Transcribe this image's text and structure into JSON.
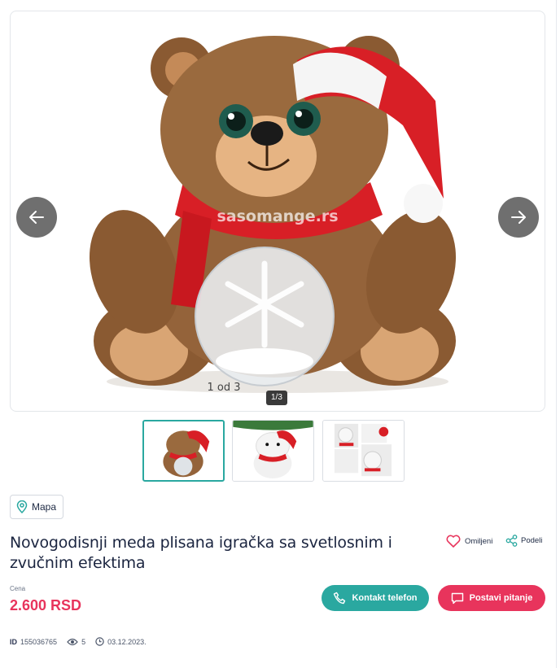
{
  "gallery": {
    "watermark": "sasomange.rs",
    "caption": "1 od 3",
    "counter": "1/3",
    "prev_icon": "arrow-left-icon",
    "next_icon": "arrow-right-icon",
    "thumbnail_count": 3,
    "active_thumbnail": 1
  },
  "location": {
    "map_label": "Mapa",
    "icon": "location-pin-icon"
  },
  "listing": {
    "title": "Novogodisnji meda plisana igračka sa svetlosnim i zvučnim efektima",
    "favorite_label": "Omiljeni",
    "share_label": "Podeli"
  },
  "price": {
    "label": "Cena",
    "value": "2.600 RSD"
  },
  "actions": {
    "contact_label": "Kontakt telefon",
    "ask_label": "Postavi pitanje"
  },
  "meta": {
    "id_label": "ID",
    "id_value": "155036765",
    "views": "5",
    "date": "03.12.2023."
  },
  "colors": {
    "accent_teal": "#2aa8a0",
    "accent_pink": "#e8345c",
    "text_dark": "#1b2540"
  }
}
